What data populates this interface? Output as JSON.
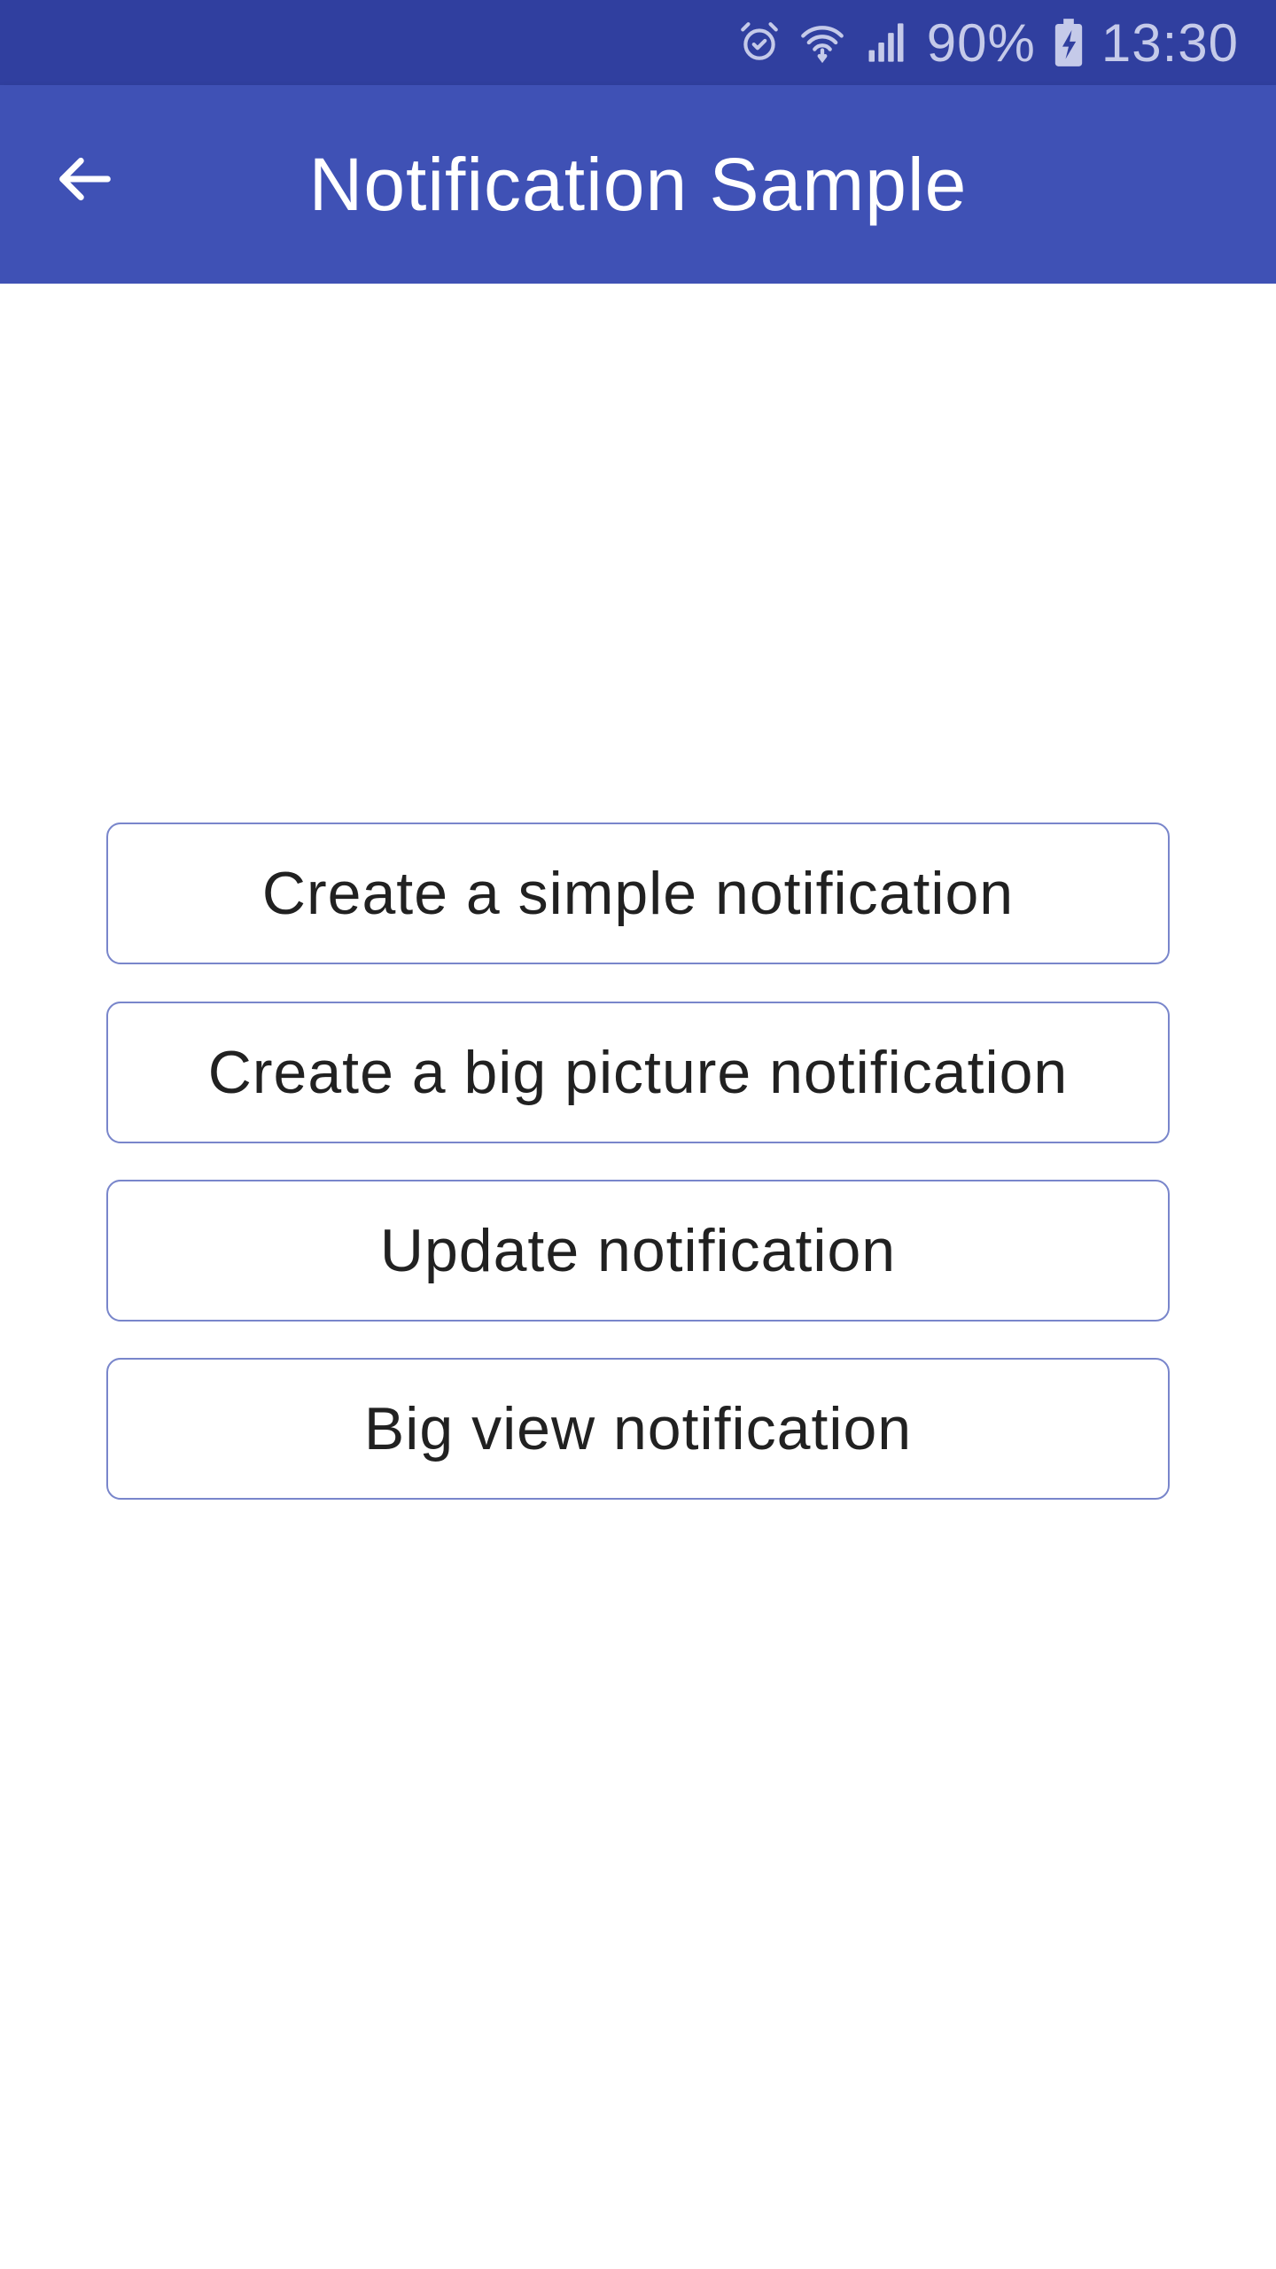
{
  "status_bar": {
    "battery": "90%",
    "time": "13:30",
    "icons": [
      "alarm-icon",
      "wifi-icon",
      "signal-icon",
      "battery-charging-icon"
    ]
  },
  "app_bar": {
    "title": "Notification Sample",
    "back_icon": "back-arrow-icon"
  },
  "buttons": {
    "simple": "Create a simple notification",
    "big_picture": "Create a big picture notification",
    "update": "Update notification",
    "big_view": "Big view notification"
  },
  "colors": {
    "status_bar": "#303f9f",
    "app_bar": "#3f51b5",
    "button_border": "#7986cb",
    "button_text": "#212121"
  }
}
